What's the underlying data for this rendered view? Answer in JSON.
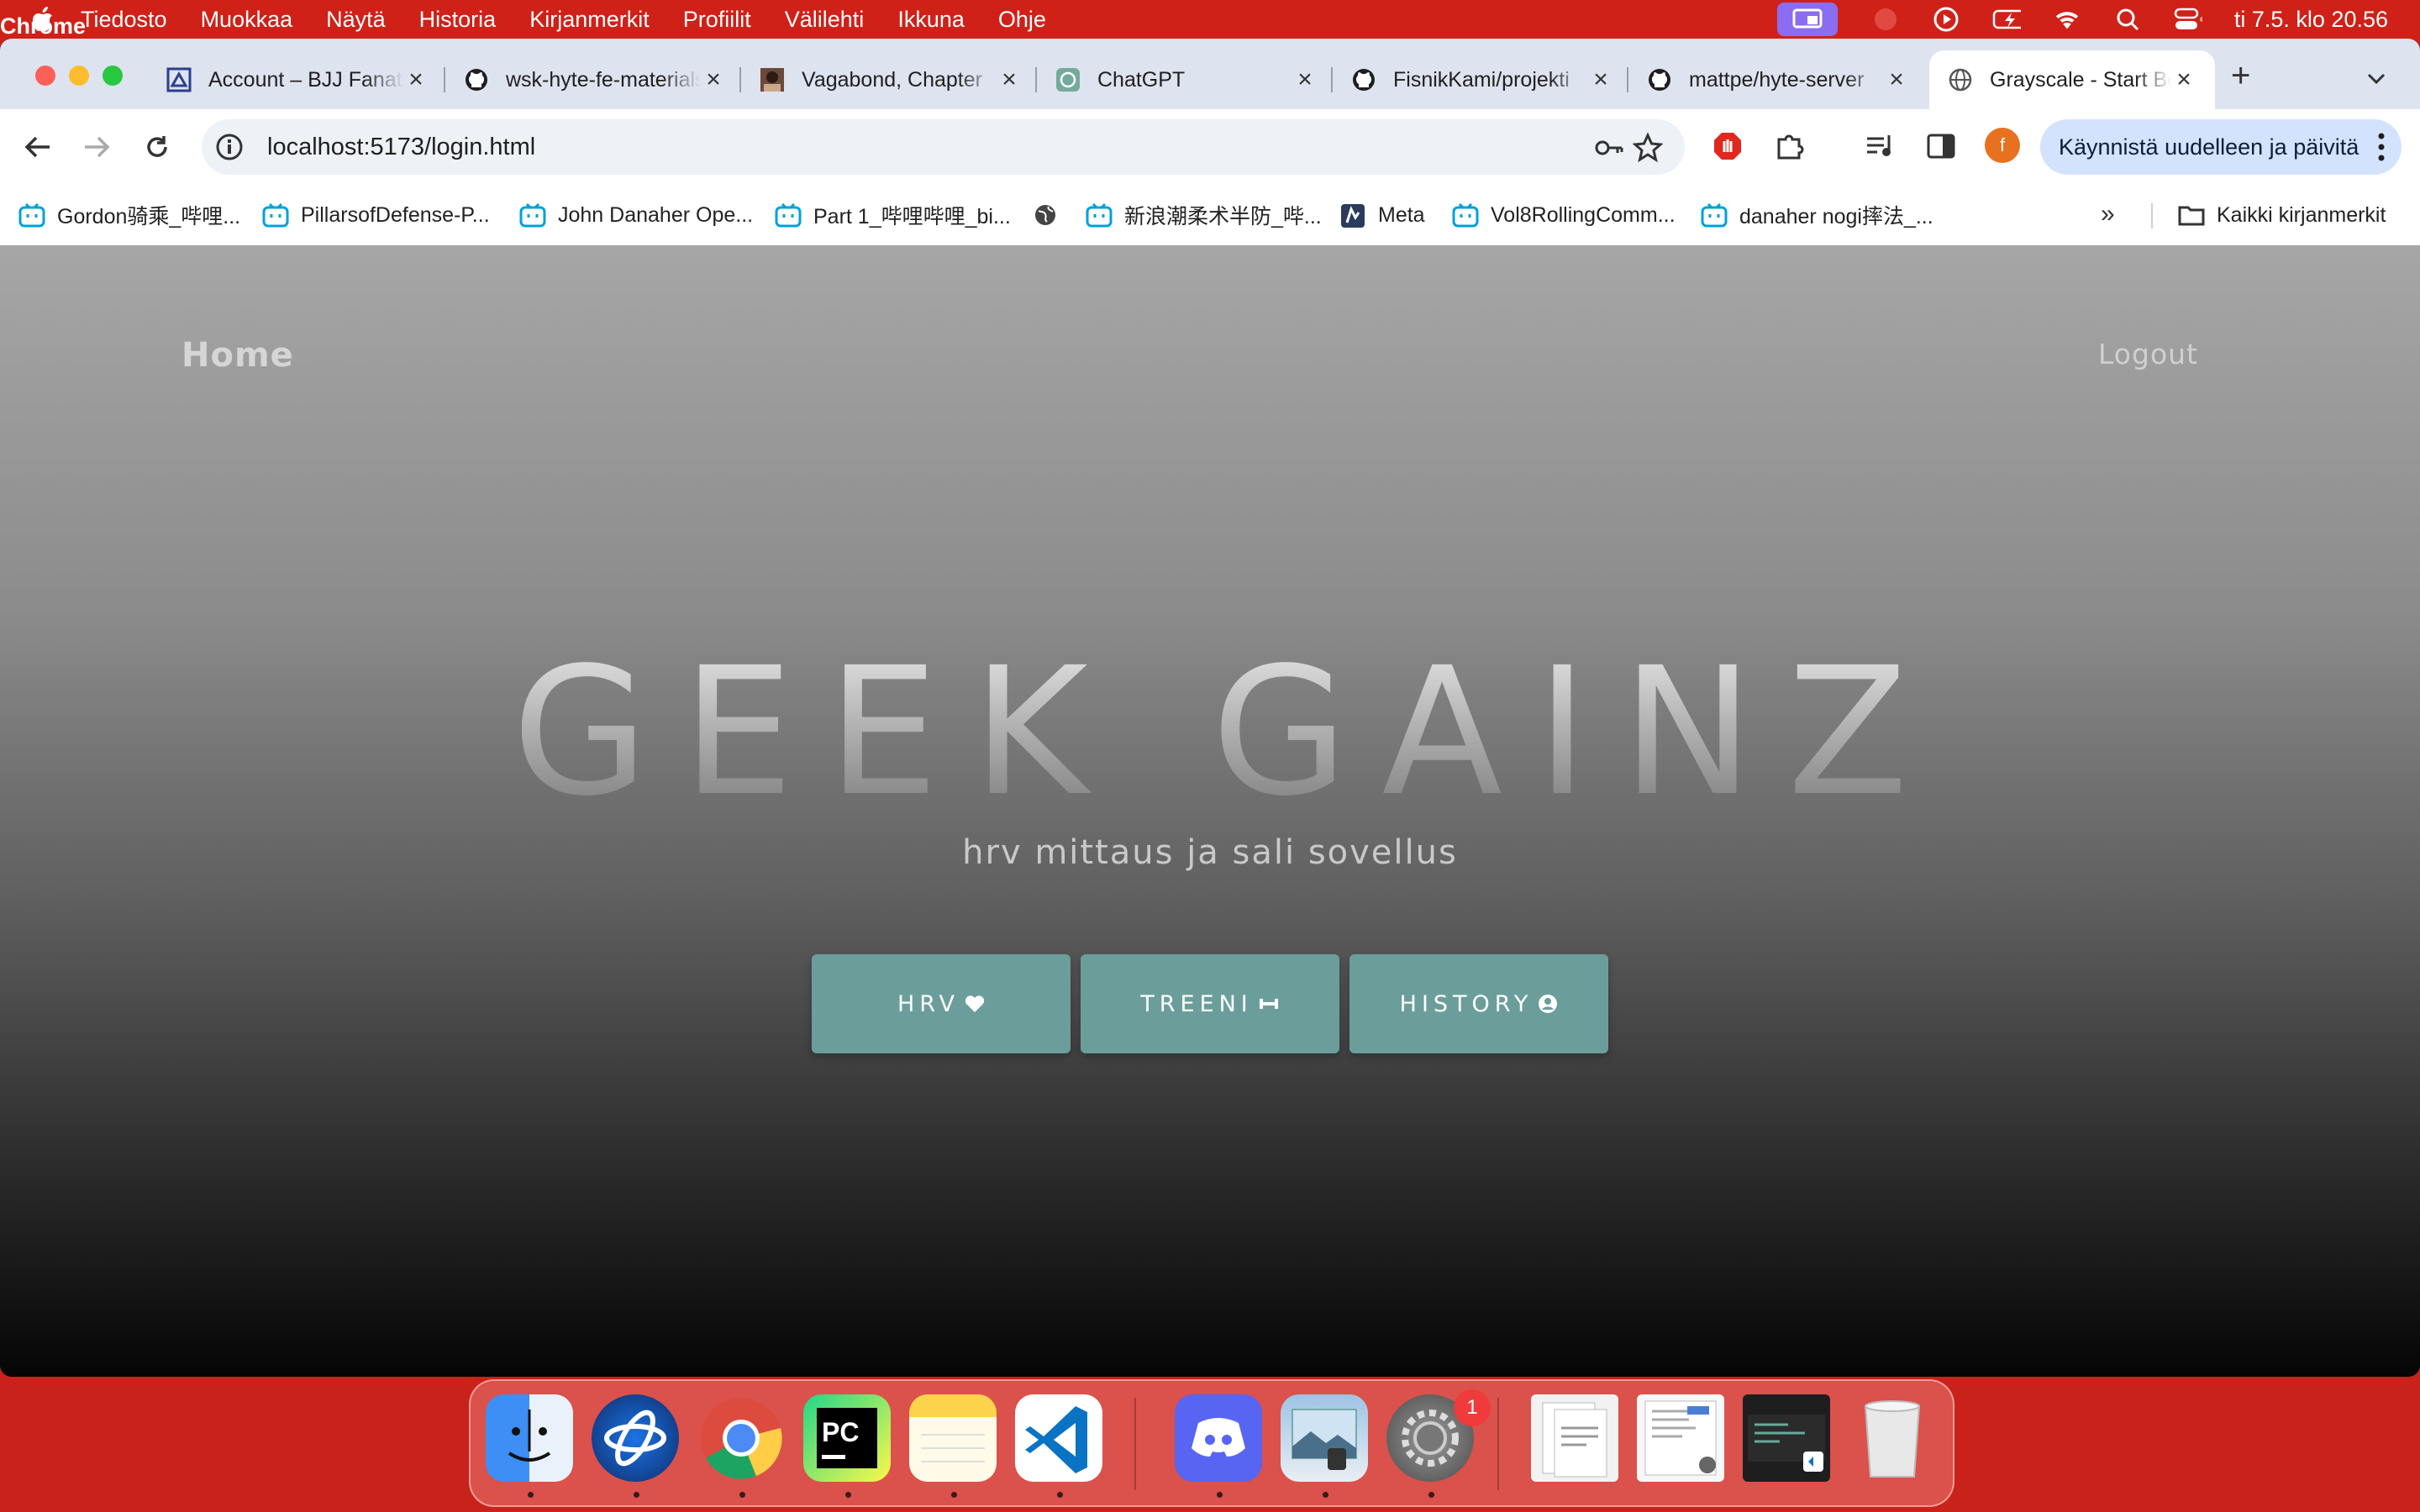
{
  "menubar": {
    "app_name": "Chrome",
    "items": [
      "Tiedosto",
      "Muokkaa",
      "Näytä",
      "Historia",
      "Kirjanmerkit",
      "Profiilit",
      "Välilehti",
      "Ikkuna",
      "Ohje"
    ],
    "clock": "ti 7.5. klo 20.56"
  },
  "tabs": [
    {
      "title": "Account – BJJ Fanatics",
      "icon": "site-logo-icon"
    },
    {
      "title": "wsk-hyte-fe-materials",
      "icon": "github-icon"
    },
    {
      "title": "Vagabond, Chapter",
      "icon": "manga-thumbnail-icon"
    },
    {
      "title": "ChatGPT",
      "icon": "chatgpt-icon"
    },
    {
      "title": "FisnikKami/projekti",
      "icon": "github-icon"
    },
    {
      "title": "mattpe/hyte-server",
      "icon": "github-icon"
    },
    {
      "title": "Grayscale - Start Bootstrap",
      "icon": "globe-icon",
      "active": true
    }
  ],
  "address_bar": {
    "url": "localhost:5173/login.html"
  },
  "profile_initial": "f",
  "update_button": "Käynnistä uudelleen ja päivitä",
  "bookmarks": [
    "Gordon骑乘_哔哩...",
    "PillarsofDefense-P...",
    "John Danaher Ope...",
    "Part 1_哔哩哔哩_bi...",
    "",
    "新浪潮柔术半防_哔...",
    "Meta",
    "Vol8RollingComm...",
    "danaher nogi摔法_..."
  ],
  "all_bookmarks": "Kaikki kirjanmerkit",
  "page": {
    "nav_home": "Home",
    "nav_logout": "Logout",
    "title": "GEEK GAINZ",
    "subtitle": "hrv mittaus ja sali sovellus",
    "buttons": [
      {
        "label": "HRV",
        "icon": "heart-icon"
      },
      {
        "label": "TREENI ",
        "icon": "dumbbell-icon"
      },
      {
        "label": "HISTORY",
        "icon": "user-circle-icon"
      }
    ]
  },
  "dock": {
    "apps": [
      "Finder",
      "Battle.net",
      "Chrome",
      "PyCharm",
      "Notes",
      "Visual Studio Code",
      "Discord",
      "Preview",
      "System Settings"
    ],
    "settings_badge": "1",
    "colors": {
      "menubar": "#cf2118",
      "button": "#6b9e9b",
      "badge": "#ef3b3b"
    }
  }
}
